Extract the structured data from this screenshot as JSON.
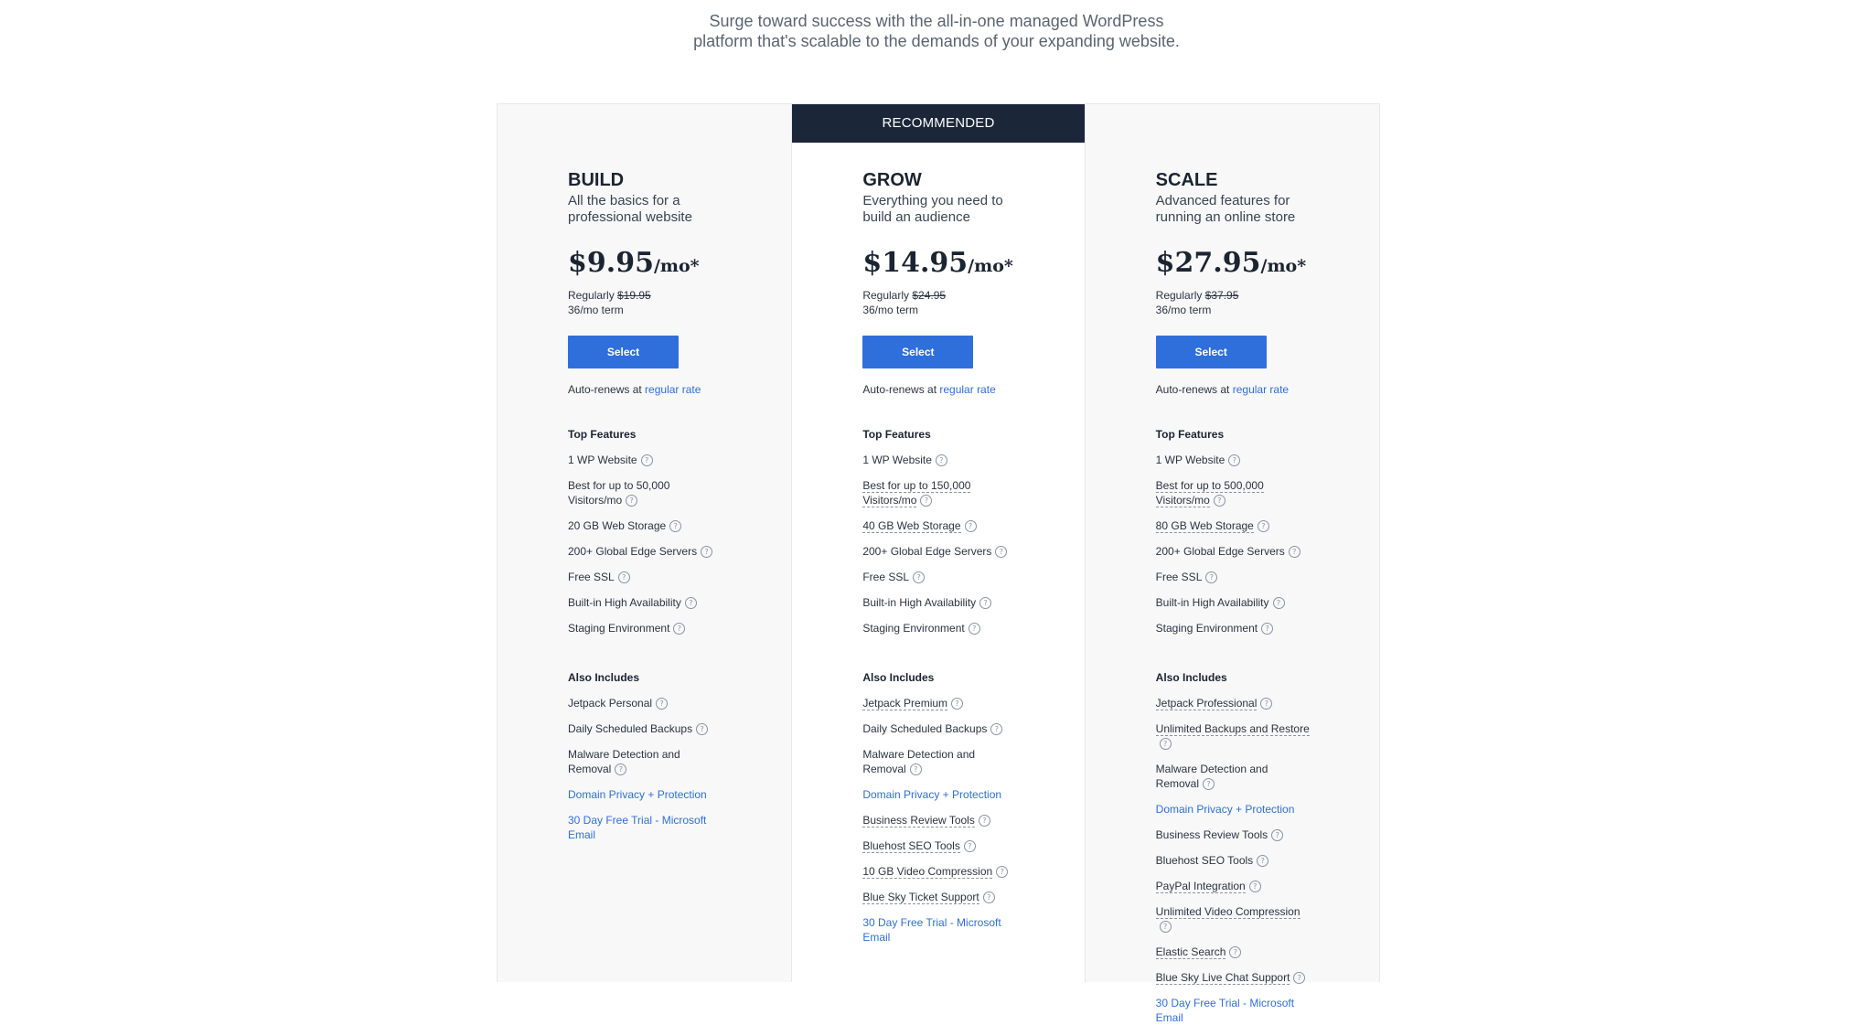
{
  "intro": {
    "line1": "Surge toward success with the all-in-one managed WordPress",
    "line2": "platform that's scalable to the demands of your expanding website."
  },
  "labels": {
    "recommended": "RECOMMENDED",
    "select": "Select",
    "autorenew_prefix": "Auto-renews at ",
    "autorenew_link": "regular rate",
    "top_features": "Top Features",
    "also_includes": "Also Includes",
    "regularly": "Regularly ",
    "per_month": "/mo*"
  },
  "plans": [
    {
      "name": "BUILD",
      "tagline": "All the basics for a professional website",
      "price": "$9.95",
      "regular_price": "$19.95",
      "term": "36/mo term",
      "recommended": false,
      "top_features": [
        {
          "text": "1 WP Website",
          "style": "plain",
          "help": true
        },
        {
          "text": "Best for up to 50,000 Visitors/mo",
          "style": "plain",
          "help": true
        },
        {
          "text": "20 GB Web Storage",
          "style": "plain",
          "help": true
        },
        {
          "text": "200+ Global Edge Servers",
          "style": "plain",
          "help": true
        },
        {
          "text": "Free SSL",
          "style": "plain",
          "help": true
        },
        {
          "text": "Built-in High Availability",
          "style": "plain",
          "help": true
        },
        {
          "text": "Staging Environment",
          "style": "plain",
          "help": true
        }
      ],
      "also_includes": [
        {
          "text": "Jetpack Personal",
          "style": "plain",
          "help": true
        },
        {
          "text": "Daily Scheduled Backups",
          "style": "plain",
          "help": true
        },
        {
          "text": "Malware Detection and Removal",
          "style": "plain",
          "help": true
        },
        {
          "text": "Domain Privacy + Protection",
          "style": "blue",
          "help": false
        },
        {
          "text": "30 Day Free Trial - Microsoft Email",
          "style": "blue",
          "help": false
        }
      ]
    },
    {
      "name": "GROW",
      "tagline": "Everything you need to build an audience",
      "price": "$14.95",
      "regular_price": "$24.95",
      "term": "36/mo term",
      "recommended": true,
      "top_features": [
        {
          "text": "1 WP Website",
          "style": "plain",
          "help": true
        },
        {
          "text": "Best for up to 150,000 Visitors/mo",
          "style": "dotted",
          "help": true
        },
        {
          "text": "40 GB Web Storage",
          "style": "dotted",
          "help": true
        },
        {
          "text": "200+ Global Edge Servers",
          "style": "plain",
          "help": true
        },
        {
          "text": "Free SSL",
          "style": "plain",
          "help": true
        },
        {
          "text": "Built-in High Availability",
          "style": "plain",
          "help": true
        },
        {
          "text": "Staging Environment",
          "style": "plain",
          "help": true
        }
      ],
      "also_includes": [
        {
          "text": "Jetpack Premium",
          "style": "dotted",
          "help": true
        },
        {
          "text": "Daily Scheduled Backups",
          "style": "plain",
          "help": true
        },
        {
          "text": "Malware Detection and Removal",
          "style": "plain",
          "help": true
        },
        {
          "text": "Domain Privacy + Protection",
          "style": "blue",
          "help": false
        },
        {
          "text": "Business Review Tools",
          "style": "dotted",
          "help": true
        },
        {
          "text": "Bluehost SEO Tools",
          "style": "dotted",
          "help": true
        },
        {
          "text": "10 GB Video Compression",
          "style": "dotted",
          "help": true
        },
        {
          "text": "Blue Sky Ticket Support",
          "style": "dotted",
          "help": true
        },
        {
          "text": "30 Day Free Trial - Microsoft Email",
          "style": "blue",
          "help": false
        }
      ]
    },
    {
      "name": "SCALE",
      "tagline": "Advanced features for running an online store",
      "price": "$27.95",
      "regular_price": "$37.95",
      "term": "36/mo term",
      "recommended": false,
      "top_features": [
        {
          "text": "1 WP Website",
          "style": "plain",
          "help": true
        },
        {
          "text": "Best for up to 500,000 Visitors/mo",
          "style": "dotted",
          "help": true
        },
        {
          "text": "80 GB Web Storage",
          "style": "dotted",
          "help": true
        },
        {
          "text": "200+ Global Edge Servers",
          "style": "plain",
          "help": true
        },
        {
          "text": "Free SSL",
          "style": "plain",
          "help": true
        },
        {
          "text": "Built-in High Availability",
          "style": "plain",
          "help": true
        },
        {
          "text": "Staging Environment",
          "style": "plain",
          "help": true
        }
      ],
      "also_includes": [
        {
          "text": "Jetpack Professional",
          "style": "dotted",
          "help": true
        },
        {
          "text": "Unlimited Backups and Restore",
          "style": "dotted",
          "help": true
        },
        {
          "text": "Malware Detection and Removal",
          "style": "plain",
          "help": true
        },
        {
          "text": "Domain Privacy + Protection",
          "style": "blue",
          "help": false
        },
        {
          "text": "Business Review Tools",
          "style": "plain",
          "help": true
        },
        {
          "text": "Bluehost SEO Tools",
          "style": "plain",
          "help": true
        },
        {
          "text": "PayPal Integration",
          "style": "dotted",
          "help": true
        },
        {
          "text": "Unlimited Video Compression",
          "style": "dotted",
          "help": true
        },
        {
          "text": "Elastic Search",
          "style": "dotted",
          "help": true
        },
        {
          "text": "Blue Sky Live Chat Support",
          "style": "dotted",
          "help": true
        },
        {
          "text": "30 Day Free Trial - Microsoft Email",
          "style": "blue",
          "help": false
        }
      ]
    }
  ],
  "colors": {
    "primary_button": "#2f6fdb",
    "banner": "#1b2739",
    "text": "#1b2431",
    "link": "#2f6fdb"
  },
  "icons": {
    "help": "question-circle-icon"
  }
}
